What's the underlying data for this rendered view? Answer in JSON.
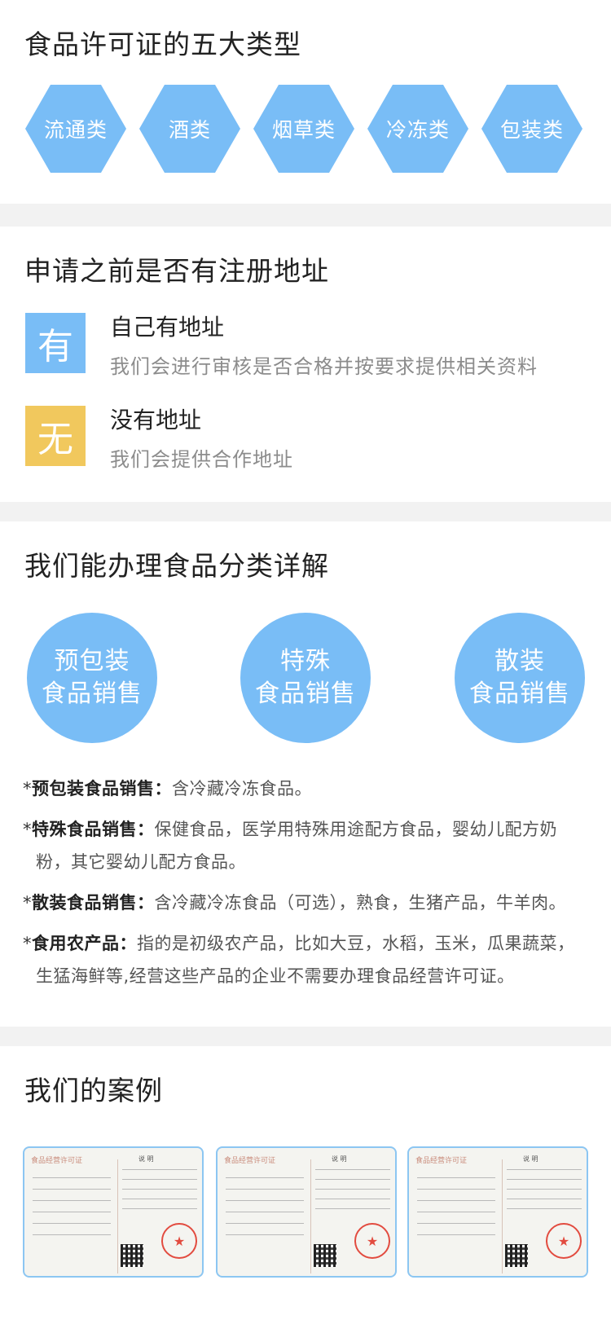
{
  "section1": {
    "title": "食品许可证的五大类型",
    "types": [
      "流通类",
      "酒类",
      "烟草类",
      "冷冻类",
      "包装类"
    ]
  },
  "section2": {
    "title": "申请之前是否有注册地址",
    "rows": [
      {
        "badge": "有",
        "title": "自己有地址",
        "desc": "我们会进行审核是否合格并按要求提供相关资料",
        "color": "#79bdf6"
      },
      {
        "badge": "无",
        "title": "没有地址",
        "desc": "我们会提供合作地址",
        "color": "#f1c85d"
      }
    ]
  },
  "section3": {
    "title": "我们能办理食品分类详解",
    "circles": [
      {
        "line1": "预包装",
        "line2": "食品销售"
      },
      {
        "line1": "特殊",
        "line2": "食品销售"
      },
      {
        "line1": "散装",
        "line2": "食品销售"
      }
    ],
    "items": [
      {
        "star": "*",
        "label": "预包装食品销售",
        "colon": "：",
        "text": "含冷藏冷冻食品。",
        "cont": ""
      },
      {
        "star": "*",
        "label": "特殊食品销售",
        "colon": "：",
        "text": "保健食品，医学用特殊用途配方食品，婴幼儿配方奶",
        "cont": "粉，其它婴幼儿配方食品。"
      },
      {
        "star": "*",
        "label": "散装食品销售",
        "colon": "：",
        "text": "含冷藏冷冻食品（可选），熟食，生猪产品，牛羊肉。",
        "cont": ""
      },
      {
        "star": "*",
        "label": "食用农产品",
        "colon": "：",
        "text": "指的是初级农产品，比如大豆，水稻，玉米，瓜果蔬菜，",
        "cont": "生猛海鲜等,经营这些产品的企业不需要办理食品经营许可证。"
      }
    ]
  },
  "section4": {
    "title": "我们的案例",
    "certs": [
      {
        "left_title": "食品经营许可证",
        "right_title": "说 明"
      },
      {
        "left_title": "食品经营许可证",
        "right_title": "说 明"
      },
      {
        "left_title": "食品经营许可证",
        "right_title": "说 明"
      }
    ]
  },
  "colors": {
    "accent_blue": "#79bdf6",
    "accent_yellow": "#f1c85d",
    "divider": "#f2f2f2"
  }
}
